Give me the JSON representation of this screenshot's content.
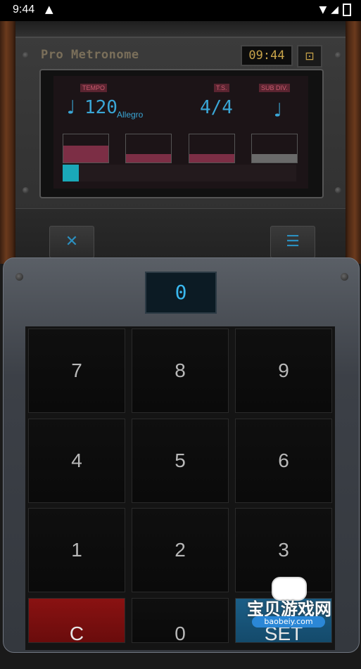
{
  "statusbar": {
    "time": "9:44",
    "alert": "▲"
  },
  "header": {
    "brand": "Pro Metronome",
    "clock": "09:44",
    "lock_icon": "lock-icon"
  },
  "display": {
    "tempo_label": "TEMPO",
    "tempo_value": "120",
    "tempo_text": "Allegro",
    "ts_label": "T.S.",
    "ts_value": "4/4",
    "subdiv_label": "SUB DIV.",
    "note_icon": "♩",
    "progress_fraction": 0.07,
    "beats": [
      {
        "accent": "#7c2e45"
      },
      {
        "accent": "#7c2e45"
      },
      {
        "accent": "#7c2e45"
      },
      {
        "accent": "#6a6a6a"
      }
    ]
  },
  "toolbar": {
    "tools_icon": "✕",
    "list_icon": "☰"
  },
  "entry": {
    "value": "0"
  },
  "keypad": {
    "keys": [
      "7",
      "8",
      "9",
      "4",
      "5",
      "6",
      "1",
      "2",
      "3",
      "C",
      "0",
      "SET"
    ]
  },
  "watermark": {
    "title": "宝贝游戏网",
    "url": "baobeiy.com"
  },
  "colors": {
    "accent": "#3aa6d6",
    "progress": "#1aa8b8"
  }
}
